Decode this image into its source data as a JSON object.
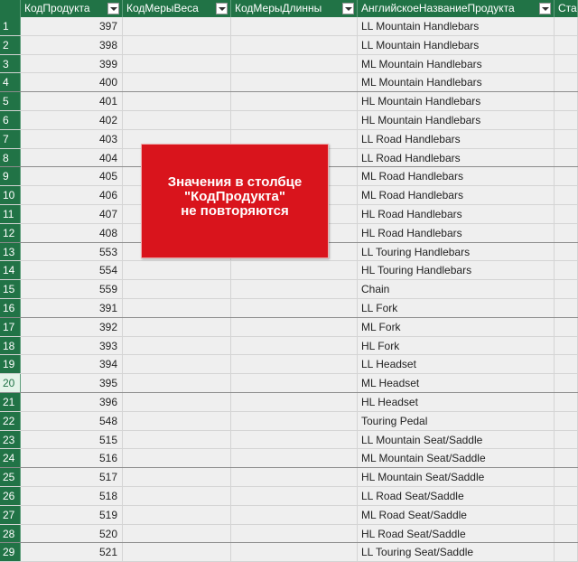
{
  "columns": [
    "КодПродукта",
    "КодМерыВеса",
    "КодМерыДлинны",
    "АнглийскоеНазваниеПродукта",
    "Ста"
  ],
  "rows": [
    {
      "n": "1",
      "code": "397",
      "name": "LL Mountain Handlebars"
    },
    {
      "n": "2",
      "code": "398",
      "name": "LL Mountain Handlebars"
    },
    {
      "n": "3",
      "code": "399",
      "name": "ML Mountain Handlebars"
    },
    {
      "n": "4",
      "code": "400",
      "name": "ML Mountain Handlebars"
    },
    {
      "n": "5",
      "code": "401",
      "name": "HL Mountain Handlebars"
    },
    {
      "n": "6",
      "code": "402",
      "name": "HL Mountain Handlebars"
    },
    {
      "n": "7",
      "code": "403",
      "name": "LL Road Handlebars"
    },
    {
      "n": "8",
      "code": "404",
      "name": "LL Road Handlebars"
    },
    {
      "n": "9",
      "code": "405",
      "name": "ML Road Handlebars"
    },
    {
      "n": "10",
      "code": "406",
      "name": "ML Road Handlebars"
    },
    {
      "n": "11",
      "code": "407",
      "name": "HL Road Handlebars"
    },
    {
      "n": "12",
      "code": "408",
      "name": "HL Road Handlebars"
    },
    {
      "n": "13",
      "code": "553",
      "name": "LL Touring Handlebars"
    },
    {
      "n": "14",
      "code": "554",
      "name": "HL Touring Handlebars"
    },
    {
      "n": "15",
      "code": "559",
      "name": "Chain"
    },
    {
      "n": "16",
      "code": "391",
      "name": "LL Fork"
    },
    {
      "n": "17",
      "code": "392",
      "name": "ML Fork"
    },
    {
      "n": "18",
      "code": "393",
      "name": "HL Fork"
    },
    {
      "n": "19",
      "code": "394",
      "name": "LL Headset"
    },
    {
      "n": "20",
      "code": "395",
      "name": "ML Headset"
    },
    {
      "n": "21",
      "code": "396",
      "name": "HL Headset"
    },
    {
      "n": "22",
      "code": "548",
      "name": "Touring Pedal"
    },
    {
      "n": "23",
      "code": "515",
      "name": "LL Mountain Seat/Saddle"
    },
    {
      "n": "24",
      "code": "516",
      "name": "ML Mountain Seat/Saddle"
    },
    {
      "n": "25",
      "code": "517",
      "name": "HL Mountain Seat/Saddle"
    },
    {
      "n": "26",
      "code": "518",
      "name": "LL Road Seat/Saddle"
    },
    {
      "n": "27",
      "code": "519",
      "name": "ML Road Seat/Saddle"
    },
    {
      "n": "28",
      "code": "520",
      "name": "HL Road Seat/Saddle"
    },
    {
      "n": "29",
      "code": "521",
      "name": "LL Touring Seat/Saddle"
    }
  ],
  "selected_row": "20",
  "annotation": "Значения в столбце\n\"КодПродукта\"\nне повторяются",
  "colors": {
    "header": "#217346",
    "note": "#d9141c"
  }
}
